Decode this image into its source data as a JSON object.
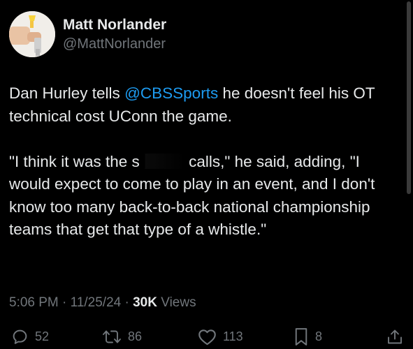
{
  "author": {
    "display_name": "Matt Norlander",
    "handle": "@MattNorlander"
  },
  "tweet": {
    "p1_before": "Dan Hurley tells ",
    "p1_mention": "@CBSSports",
    "p1_after": " he doesn't feel his OT technical cost UConn the game.",
    "p2_before": "\"I think it was the s",
    "p2_after": " calls,\" he said, adding, \"I would expect to come to play in an event, and I don't know too many back-to-back national championship teams that get that type of a whistle.\""
  },
  "meta": {
    "time": "5:06 PM",
    "separator": "·",
    "date": "11/25/24",
    "views_count": "30K",
    "views_label": "Views"
  },
  "actions": {
    "replies": "52",
    "reposts": "86",
    "likes": "113",
    "bookmarks": "8"
  },
  "icons": {
    "reply": "reply-icon",
    "repost": "repost-icon",
    "like": "heart-icon",
    "bookmark": "bookmark-icon",
    "share": "share-icon"
  },
  "colors": {
    "background": "#000000",
    "text": "#e7e9ea",
    "secondary": "#71767b",
    "link": "#1d9bf0"
  }
}
